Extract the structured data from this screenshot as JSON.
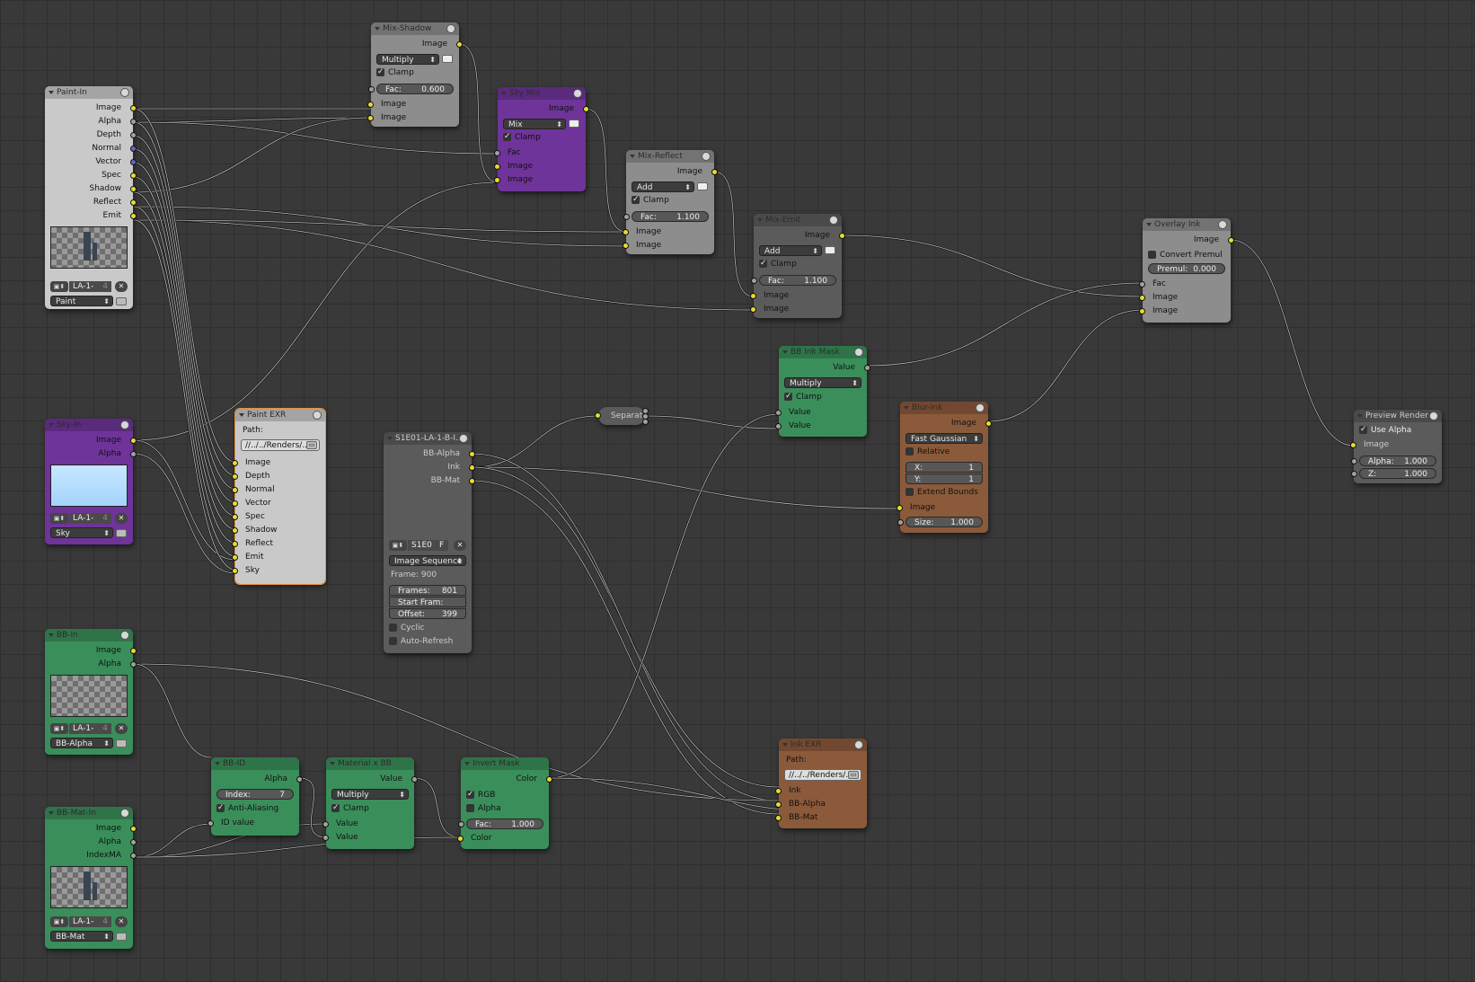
{
  "nodes": {
    "paint_in": {
      "title": "Paint-In",
      "outputs": [
        "Image",
        "Alpha",
        "Depth",
        "Normal",
        "Vector",
        "Spec",
        "Shadow",
        "Reflect",
        "Emit"
      ],
      "image_name": "LA-1-",
      "users": "4",
      "layer": "Paint"
    },
    "sky_in": {
      "title": "Sky-In",
      "outputs": [
        "Image",
        "Alpha"
      ],
      "image_name": "LA-1-",
      "users": "4",
      "layer": "Sky"
    },
    "bb_in": {
      "title": "BB-In",
      "outputs": [
        "Image",
        "Alpha"
      ],
      "image_name": "LA-1-",
      "users": "4",
      "layer": "BB-Alpha"
    },
    "bb_mat_in": {
      "title": "BB-Mat-In",
      "outputs": [
        "Image",
        "Alpha",
        "IndexMA"
      ],
      "image_name": "LA-1-",
      "users": "4",
      "layer": "BB-Mat"
    },
    "mix_shadow": {
      "title": "Mix-Shadow",
      "output": "Image",
      "blend": "Multiply",
      "clamp": "Clamp",
      "fac_label": "Fac:",
      "fac": "0.600",
      "inputs": [
        "Image",
        "Image"
      ]
    },
    "sky_mix": {
      "title": "Sky Mix",
      "output": "Image",
      "blend": "Mix",
      "clamp": "Clamp",
      "inputs": [
        "Fac",
        "Image",
        "Image"
      ]
    },
    "mix_reflect": {
      "title": "Mix-Reflect",
      "output": "Image",
      "blend": "Add",
      "clamp": "Clamp",
      "fac_label": "Fac:",
      "fac": "1.100",
      "inputs": [
        "Image",
        "Image"
      ]
    },
    "mix_emit": {
      "title": "Mix-Emit",
      "output": "Image",
      "blend": "Add",
      "clamp": "Clamp",
      "fac_label": "Fac:",
      "fac": "1.100",
      "inputs": [
        "Image",
        "Image"
      ]
    },
    "overlay_ink": {
      "title": "Overlay Ink",
      "output": "Image",
      "convert_premul": "Convert Premul",
      "premul_label": "Premul:",
      "premul": "0.000",
      "inputs": [
        "Fac",
        "Image",
        "Image"
      ]
    },
    "preview_render": {
      "title": "Preview Render",
      "use_alpha": "Use Alpha",
      "inputs": [
        "Image"
      ],
      "alpha_label": "Alpha:",
      "alpha": "1.000",
      "z_label": "Z:",
      "z": "1.000"
    },
    "paint_exr": {
      "title": "Paint EXR",
      "path_label": "Path:",
      "path": "//../../Renders/...",
      "inputs": [
        "Image",
        "Depth",
        "Normal",
        "Vector",
        "Spec",
        "Shadow",
        "Reflect",
        "Emit",
        "Sky"
      ]
    },
    "s1e01": {
      "title": "S1E01-LA-1-B-I...",
      "outputs": [
        "BB-Alpha",
        "Ink",
        "BB-Mat"
      ],
      "img_name": "S1E0",
      "img_flag": "F",
      "source": "Image Sequence",
      "frame": "Frame: 900",
      "frames_label": "Frames:",
      "frames": "801",
      "start_label": "Start Fram:",
      "start": "400",
      "offset_label": "Offset:",
      "offset": "399",
      "cyclic": "Cyclic",
      "auto_refresh": "Auto-Refresh"
    },
    "separate": {
      "title": "Separat"
    },
    "bb_ink_mask": {
      "title": "BB Ink Mask",
      "output": "Value",
      "blend": "Multiply",
      "clamp": "Clamp",
      "inputs": [
        "Value",
        "Value"
      ]
    },
    "blur_ink": {
      "title": "Blur-Ink",
      "output": "Image",
      "filter": "Fast Gaussian",
      "relative": "Relative",
      "x_label": "X:",
      "x": "1",
      "y_label": "Y:",
      "y": "1",
      "extend": "Extend Bounds",
      "inputs": [
        "Image"
      ],
      "size_label": "Size:",
      "size": "1.000"
    },
    "bb_id": {
      "title": "BB-ID",
      "output": "Alpha",
      "index_label": "Index:",
      "index": "7",
      "anti_aliasing": "Anti-Aliasing",
      "inputs": [
        "ID value"
      ]
    },
    "material_x_bb": {
      "title": "Material x BB",
      "output": "Value",
      "blend": "Multiply",
      "clamp": "Clamp",
      "inputs": [
        "Value",
        "Value"
      ]
    },
    "invert_mask": {
      "title": "Invert Mask",
      "output": "Color",
      "rgb": "RGB",
      "alpha": "Alpha",
      "fac_label": "Fac:",
      "fac": "1.000",
      "inputs": [
        "Color"
      ]
    },
    "ink_exr": {
      "title": "Ink EXR",
      "path_label": "Path:",
      "path": "//../../Renders/...",
      "inputs": [
        "Ink",
        "BB-Alpha",
        "BB-Mat"
      ]
    }
  },
  "colors": {
    "grid_bg": "#393939",
    "socket_color": "#e6dc2e",
    "socket_value": "#a1a1a1",
    "socket_vector": "#6363c7",
    "purple_node": "#6e3499",
    "green_node": "#3a8e5a",
    "brown_node": "#8b5a3b"
  }
}
